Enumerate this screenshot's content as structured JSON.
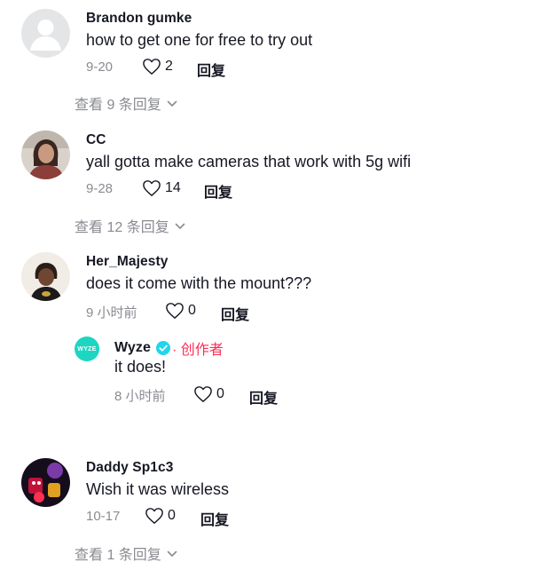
{
  "comments": [
    {
      "author": "Brandon gumke",
      "text": "how to get one for free to try out",
      "date": "9-20",
      "likes": "2",
      "reply_label": "回复",
      "view_replies": "查看 9 条回复"
    },
    {
      "author": "CC",
      "text": "yall gotta make cameras that work with 5g wifi",
      "date": "9-28",
      "likes": "14",
      "reply_label": "回复",
      "view_replies": "查看 12 条回复"
    },
    {
      "author": "Her_Majesty",
      "text": "does it come with the mount???",
      "date": "9 小时前",
      "likes": "0",
      "reply_label": "回复",
      "reply": {
        "author": "Wyze",
        "avatar_text": "WYZE",
        "creator_label": "· 创作者",
        "text": "it does!",
        "date": "8 小时前",
        "likes": "0",
        "reply_label": "回复"
      }
    },
    {
      "author": "Daddy Sp1c3",
      "text": "Wish it was wireless",
      "date": "10-17",
      "likes": "0",
      "reply_label": "回复",
      "view_replies": "查看 1 条回复"
    }
  ],
  "colors": {
    "creator_accent": "#fe2c55",
    "verified_badge": "#20d5ec",
    "wyze_brand": "#1dd6c1",
    "secondary_text": "#8a8b91"
  },
  "icons": {
    "like": "heart-outline-icon",
    "expand": "chevron-down-icon",
    "verified": "verified-check-icon"
  }
}
